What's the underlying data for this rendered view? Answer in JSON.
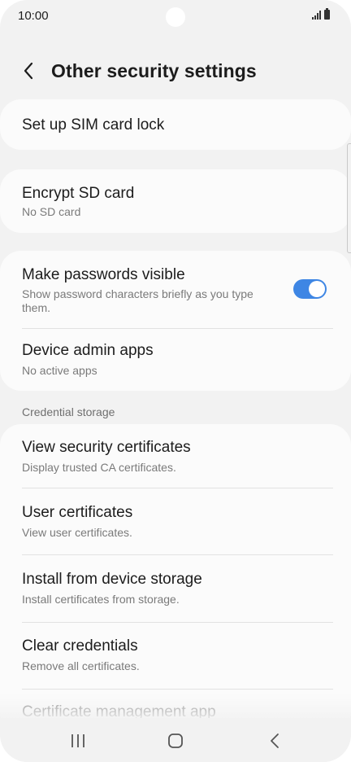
{
  "status_bar": {
    "time": "10:00"
  },
  "header": {
    "back_icon": "chevron-left-icon",
    "title": "Other security settings"
  },
  "cards": {
    "sim_lock": {
      "title": "Set up SIM card lock"
    },
    "encrypt_sd": {
      "title": "Encrypt SD card",
      "subtitle": "No SD card"
    },
    "passwords_visible": {
      "title": "Make passwords visible",
      "subtitle_line1": "Show password characters briefly as you type",
      "subtitle_line2": "them.",
      "toggle_on": true
    },
    "device_admin": {
      "title": "Device admin apps",
      "subtitle": "No active apps"
    }
  },
  "section": {
    "credential_storage_label": "Credential storage"
  },
  "credentials": [
    {
      "title": "View security certificates",
      "subtitle": "Display trusted CA certificates."
    },
    {
      "title": "User certificates",
      "subtitle": "View user certificates."
    },
    {
      "title": "Install from device storage",
      "subtitle": "Install certificates from storage."
    },
    {
      "title": "Clear credentials",
      "subtitle": "Remove all certificates."
    },
    {
      "title": "Certificate management app"
    }
  ],
  "nav_bar": {
    "recents_icon": "recents-icon",
    "home_icon": "home-icon",
    "back_icon": "back-icon"
  },
  "colors": {
    "accent": "#3e86e4",
    "background": "#f2f2f2",
    "card": "#fbfbfb"
  }
}
